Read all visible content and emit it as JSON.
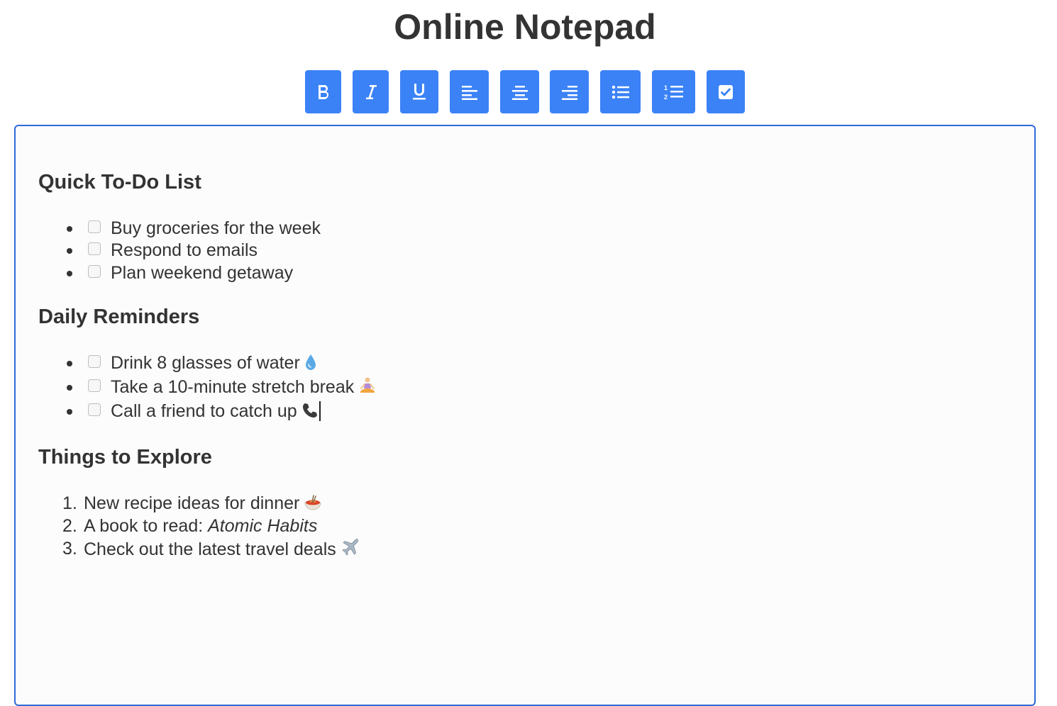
{
  "app": {
    "title": "Online Notepad"
  },
  "toolbar": {
    "buttons": [
      {
        "name": "bold",
        "icon": "bold-icon"
      },
      {
        "name": "italic",
        "icon": "italic-icon"
      },
      {
        "name": "underline",
        "icon": "underline-icon"
      },
      {
        "name": "align-left",
        "icon": "align-left-icon"
      },
      {
        "name": "align-center",
        "icon": "align-center-icon"
      },
      {
        "name": "align-right",
        "icon": "align-right-icon"
      },
      {
        "name": "bullet-list",
        "icon": "bullet-list-icon"
      },
      {
        "name": "numbered-list",
        "icon": "numbered-list-icon"
      },
      {
        "name": "checkbox-list",
        "icon": "checkbox-icon"
      }
    ],
    "accent_color": "#3b82f6"
  },
  "editor": {
    "border_color": "#2f6bd8",
    "sections": [
      {
        "heading": "Quick To-Do List",
        "type": "checklist",
        "items": [
          {
            "text": "Buy groceries for the week",
            "checked": false,
            "emoji": ""
          },
          {
            "text": "Respond to emails",
            "checked": false,
            "emoji": ""
          },
          {
            "text": "Plan weekend getaway",
            "checked": false,
            "emoji": ""
          }
        ]
      },
      {
        "heading": "Daily Reminders",
        "type": "checklist",
        "items": [
          {
            "text": "Drink 8 glasses of water",
            "checked": false,
            "emoji": "water-drop-icon"
          },
          {
            "text": "Take a 10-minute stretch break",
            "checked": false,
            "emoji": "meditation-icon"
          },
          {
            "text": "Call a friend to catch up",
            "checked": false,
            "emoji": "telephone-icon"
          }
        ]
      },
      {
        "heading": "Things to Explore",
        "type": "ordered",
        "items": [
          {
            "number": "1.",
            "text": "New recipe ideas for dinner",
            "emoji": "pasta-icon"
          },
          {
            "number": "2.",
            "text_prefix": "A book to read: ",
            "text_italic": "Atomic Habits"
          },
          {
            "number": "3.",
            "text": "Check out the latest travel deals",
            "emoji": "airplane-icon"
          }
        ]
      }
    ]
  }
}
